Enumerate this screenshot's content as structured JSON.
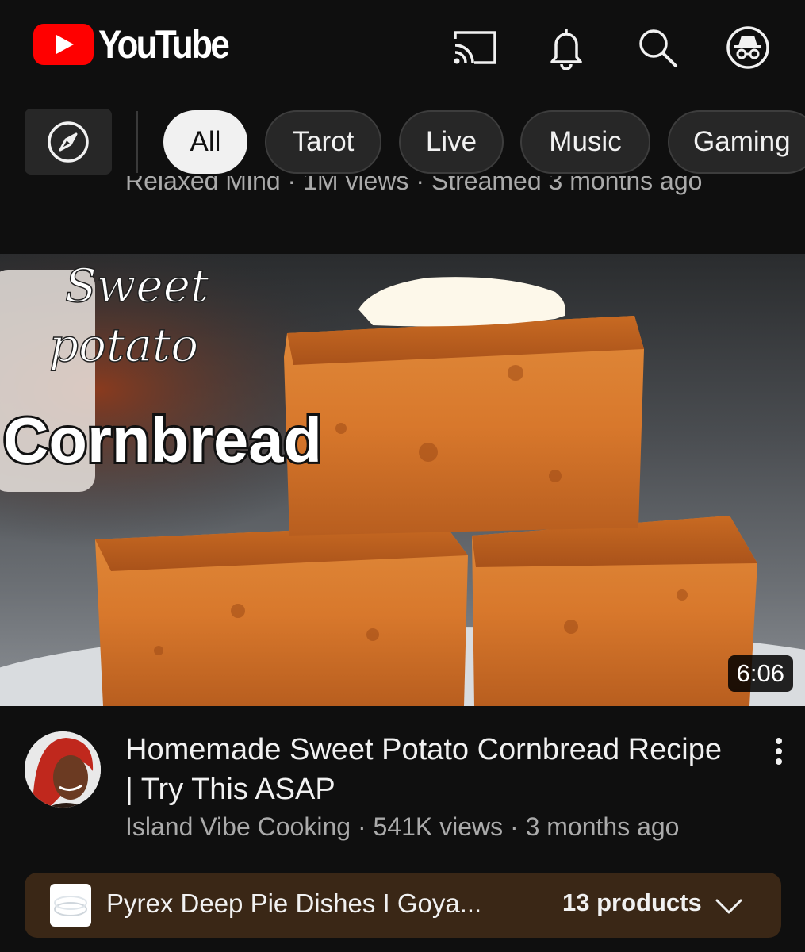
{
  "header": {
    "logo_text": "YouTube",
    "icons": [
      "cast-icon",
      "bell-icon",
      "search-icon",
      "incognito-icon"
    ]
  },
  "chips": {
    "explore_icon": "compass-icon",
    "items": [
      "All",
      "Tarot",
      "Live",
      "Music",
      "Gaming"
    ],
    "active": "All"
  },
  "previous_video": {
    "meta": "Relaxed Mind · 1M views · Streamed 3 months ago"
  },
  "video": {
    "thumbnail_text": {
      "line1": "Sweet",
      "line2": "potato",
      "line3": "Cornbread"
    },
    "duration": "6:06",
    "title": "Homemade Sweet Potato Cornbread Recipe | Try This ASAP",
    "channel": "Island Vibe Cooking",
    "views": "541K views",
    "age": "3 months ago",
    "separator": " · "
  },
  "products_bar": {
    "title": "Pyrex Deep Pie Dishes I Goya...",
    "count": "13 products"
  },
  "colors": {
    "background": "#0f0f0f",
    "chip_bg": "#272727",
    "brand_red": "#ff0000",
    "products_bar_bg": "#3a2716",
    "secondary_text": "#aaaaaa"
  }
}
